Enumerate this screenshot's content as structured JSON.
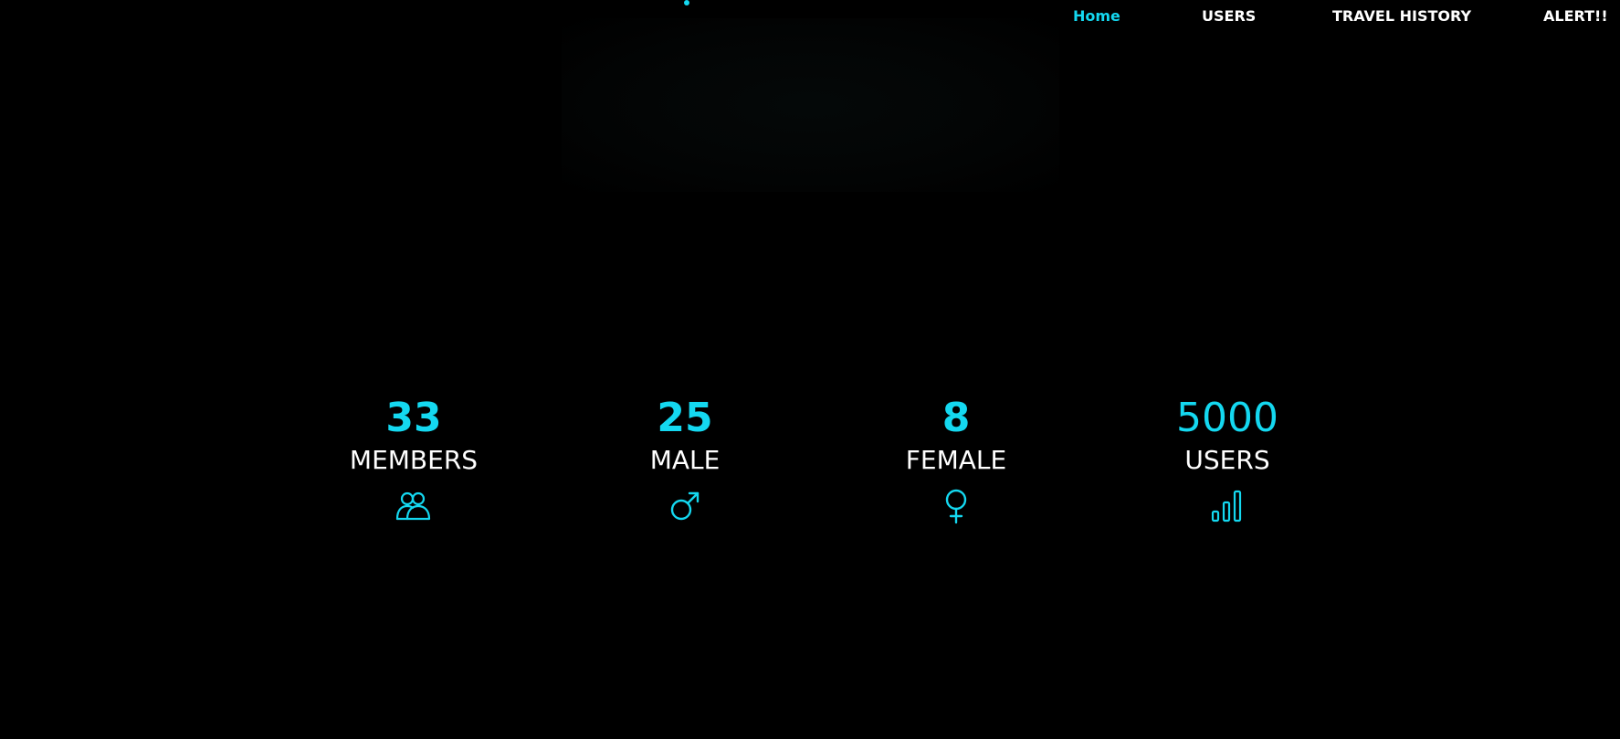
{
  "nav": {
    "home": "Home",
    "users": "USERS",
    "travel_history": "TRAVEL HISTORY",
    "alert": "ALERT!!",
    "active": "home"
  },
  "stats": {
    "members": {
      "value": "33",
      "label": "MEMBERS",
      "icon": "members-icon"
    },
    "male": {
      "value": "25",
      "label": "MALE",
      "icon": "male-icon"
    },
    "female": {
      "value": "8",
      "label": "FEMALE",
      "icon": "female-icon"
    },
    "users": {
      "value": "5000",
      "label": "USERS",
      "icon": "bar-chart-icon"
    }
  },
  "colors": {
    "accent": "#14d8f0",
    "text": "#ffffff",
    "background": "#000000"
  }
}
